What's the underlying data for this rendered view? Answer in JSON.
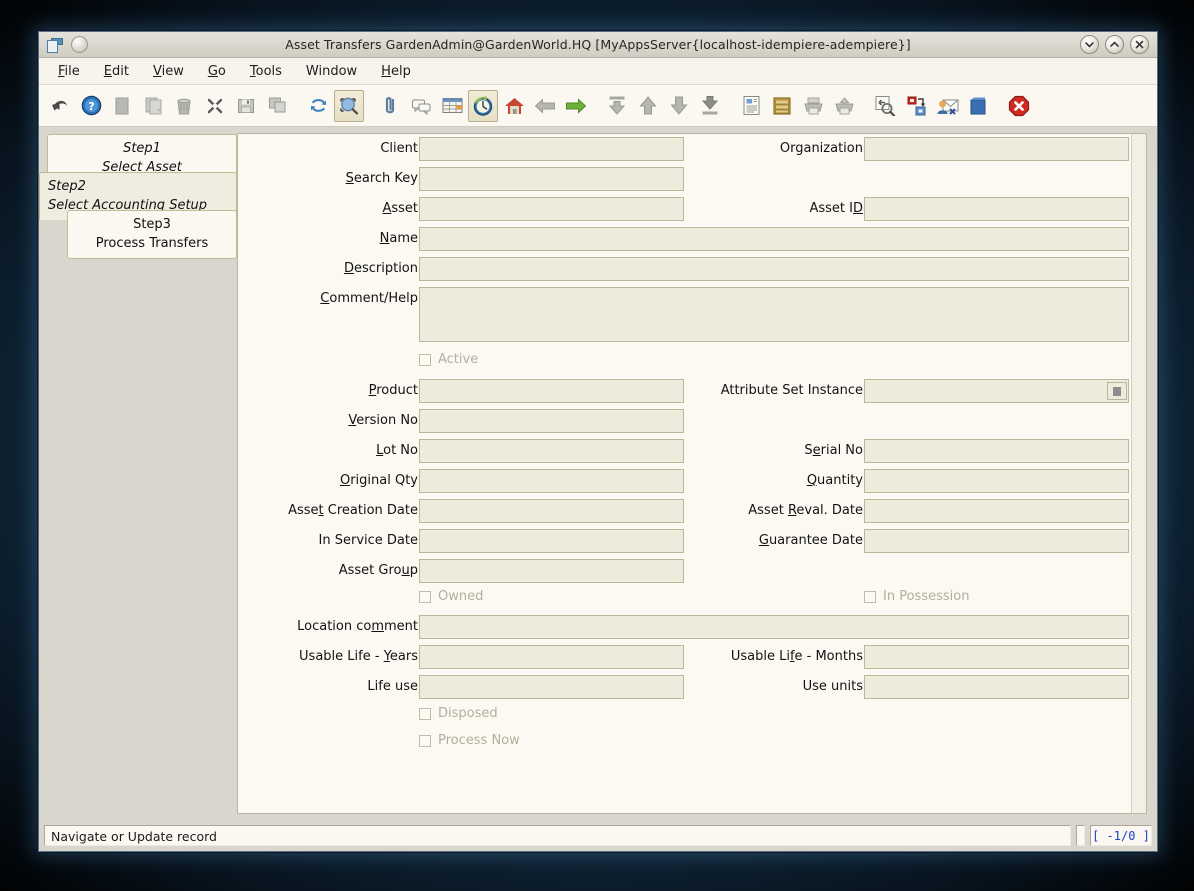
{
  "window": {
    "title": "Asset Transfers  GardenAdmin@GardenWorld.HQ [MyAppsServer{localhost-idempiere-adempiere}]",
    "icon": "window-app-icon",
    "controls": [
      {
        "name": "minimize-button",
        "glyph": "chevron-down-icon"
      },
      {
        "name": "maximize-button",
        "glyph": "chevron-up-icon"
      },
      {
        "name": "close-button",
        "glyph": "close-x-icon"
      }
    ]
  },
  "menubar": {
    "items": [
      {
        "label": "File",
        "mnemonic": "F"
      },
      {
        "label": "Edit",
        "mnemonic": "E"
      },
      {
        "label": "View",
        "mnemonic": "V"
      },
      {
        "label": "Go",
        "mnemonic": "G"
      },
      {
        "label": "Tools",
        "mnemonic": "T"
      },
      {
        "label": "Window",
        "mnemonic": ""
      },
      {
        "label": "Help",
        "mnemonic": "H"
      }
    ]
  },
  "toolbar": {
    "buttons": [
      {
        "icon": "undo-arrow-icon",
        "selected": false
      },
      {
        "icon": "help-question-icon",
        "selected": false
      },
      {
        "icon": "new-record-icon",
        "selected": false
      },
      {
        "icon": "copy-record-icon",
        "selected": false
      },
      {
        "icon": "delete-trash-icon",
        "selected": false
      },
      {
        "icon": "delete-selection-scissors-icon",
        "selected": false
      },
      {
        "icon": "save-floppy-icon",
        "selected": false
      },
      {
        "icon": "save-create-new-icon",
        "selected": false
      },
      {
        "sep": true
      },
      {
        "icon": "refresh-arrows-icon",
        "selected": false
      },
      {
        "icon": "find-magnifier-icon",
        "selected": true
      },
      {
        "sep": true
      },
      {
        "icon": "attachment-paperclip-icon",
        "selected": false
      },
      {
        "icon": "chat-note-icon",
        "selected": false
      },
      {
        "icon": "grid-toggle-icon",
        "selected": false
      },
      {
        "icon": "history-records-icon",
        "selected": true
      },
      {
        "icon": "home-house-icon",
        "selected": false
      },
      {
        "icon": "back-arrow-icon",
        "selected": false
      },
      {
        "icon": "forward-arrow-icon",
        "selected": false
      },
      {
        "sep": true
      },
      {
        "icon": "first-record-icon",
        "selected": false
      },
      {
        "icon": "previous-record-icon",
        "selected": false
      },
      {
        "icon": "next-record-icon",
        "selected": false
      },
      {
        "icon": "last-record-icon",
        "selected": false
      },
      {
        "sep": true
      },
      {
        "icon": "report-document-icon",
        "selected": false
      },
      {
        "icon": "archive-cabinet-icon",
        "selected": false
      },
      {
        "icon": "print-preview-icon",
        "selected": false
      },
      {
        "icon": "print-icon",
        "selected": false
      },
      {
        "sep": true
      },
      {
        "icon": "zoom-across-icon",
        "selected": false
      },
      {
        "icon": "active-workflow-icon",
        "selected": false
      },
      {
        "icon": "request-mail-icon",
        "selected": false
      },
      {
        "icon": "product-info-icon",
        "selected": false
      },
      {
        "sep": true
      },
      {
        "icon": "exit-close-icon",
        "selected": false
      }
    ]
  },
  "steps": [
    {
      "line1": "Step1",
      "line2": "Select Asset",
      "active": false
    },
    {
      "line1": "Step2",
      "line2": "Select Accounting Setup",
      "active": true
    },
    {
      "line1": "Step3",
      "line2": "Process Transfers",
      "active": false
    }
  ],
  "form": {
    "fields": [
      {
        "label": "Client",
        "mnemonic": "",
        "value": "",
        "col": "left"
      },
      {
        "label": "Organization",
        "mnemonic": "",
        "value": "",
        "col": "right"
      },
      {
        "label": "Search Key",
        "mnemonic": "S",
        "value": "",
        "col": "left"
      },
      {
        "label": "Asset",
        "mnemonic": "A",
        "value": "",
        "col": "left"
      },
      {
        "label": "Asset ID",
        "mnemonic": "D",
        "value": "",
        "col": "right"
      },
      {
        "label": "Name",
        "mnemonic": "N",
        "value": "",
        "col": "wide"
      },
      {
        "label": "Description",
        "mnemonic": "D",
        "value": "",
        "col": "wide"
      },
      {
        "label": "Comment/Help",
        "mnemonic": "C",
        "value": "",
        "col": "textarea"
      },
      {
        "label": "Product",
        "mnemonic": "P",
        "value": "",
        "col": "left"
      },
      {
        "label": "Attribute Set Instance",
        "mnemonic": "",
        "value": "",
        "col": "right-btn"
      },
      {
        "label": "Version No",
        "mnemonic": "V",
        "value": "",
        "col": "left"
      },
      {
        "label": "Lot No",
        "mnemonic": "L",
        "value": "",
        "col": "left"
      },
      {
        "label": "Serial No",
        "mnemonic": "e",
        "value": "",
        "col": "right"
      },
      {
        "label": "Original Qty",
        "mnemonic": "O",
        "value": "",
        "col": "left"
      },
      {
        "label": "Quantity",
        "mnemonic": "Q",
        "value": "",
        "col": "right"
      },
      {
        "label": "Asset Creation Date",
        "mnemonic": "t",
        "value": "",
        "col": "left"
      },
      {
        "label": "Asset Reval. Date",
        "mnemonic": "R",
        "value": "",
        "col": "right"
      },
      {
        "label": "In Service Date",
        "mnemonic": "",
        "value": "",
        "col": "left"
      },
      {
        "label": "Guarantee Date",
        "mnemonic": "G",
        "value": "",
        "col": "right"
      },
      {
        "label": "Asset Group",
        "mnemonic": "u",
        "value": "",
        "col": "left"
      },
      {
        "label": "Location comment",
        "mnemonic": "m",
        "value": "",
        "col": "wide"
      },
      {
        "label": "Usable Life - Years",
        "mnemonic": "Y",
        "value": "",
        "col": "left"
      },
      {
        "label": "Usable Life - Months",
        "mnemonic": "f",
        "value": "",
        "col": "right"
      },
      {
        "label": "Life use",
        "mnemonic": "",
        "value": "",
        "col": "left"
      },
      {
        "label": "Use units",
        "mnemonic": "",
        "value": "",
        "col": "right"
      }
    ],
    "checkboxes": [
      {
        "label": "Active",
        "checked": false,
        "enabled": false
      },
      {
        "label": "Owned",
        "checked": false,
        "enabled": false
      },
      {
        "label": "In Possession",
        "checked": false,
        "enabled": false
      },
      {
        "label": "Disposed",
        "checked": false,
        "enabled": false
      },
      {
        "label": "Process Now",
        "checked": false,
        "enabled": false
      }
    ]
  },
  "statusbar": {
    "message": "Navigate or Update record",
    "record_counter": "[ -1/0 ]"
  },
  "colors": {
    "window_bg": "#d9d7cd",
    "form_bg": "#fbf9f2",
    "field_bg": "#edebdc",
    "field_border": "#bdb69c",
    "accent_blue": "#1b3fbe",
    "disabled_text": "#b4ae9c"
  }
}
